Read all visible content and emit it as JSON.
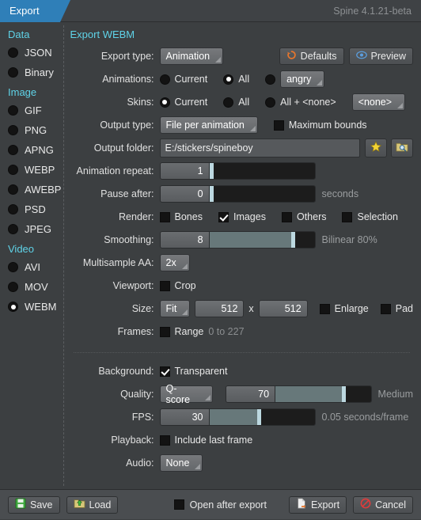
{
  "titlebar": {
    "tab_label": "Export",
    "app_title": "Spine 4.1.21-beta"
  },
  "sidebar": {
    "sections": [
      {
        "title": "Data",
        "items": [
          {
            "label": "JSON"
          },
          {
            "label": "Binary"
          }
        ]
      },
      {
        "title": "Image",
        "items": [
          {
            "label": "GIF"
          },
          {
            "label": "PNG"
          },
          {
            "label": "APNG"
          },
          {
            "label": "WEBP"
          },
          {
            "label": "AWEBP"
          },
          {
            "label": "PSD"
          },
          {
            "label": "JPEG"
          }
        ]
      },
      {
        "title": "Video",
        "items": [
          {
            "label": "AVI"
          },
          {
            "label": "MOV"
          },
          {
            "label": "WEBM"
          }
        ]
      }
    ],
    "selected": "WEBM"
  },
  "main": {
    "heading": "Export WEBM",
    "export_type": {
      "label": "Export type:",
      "value": "Animation"
    },
    "defaults_button": "Defaults",
    "preview_button": "Preview",
    "animations": {
      "label": "Animations:",
      "opt_current": "Current",
      "opt_all": "All",
      "selected_animation": "angry"
    },
    "skins": {
      "label": "Skins:",
      "opt_current": "Current",
      "opt_all": "All",
      "opt_all_none": "All + <none>",
      "selected_skin": "<none>"
    },
    "output_type": {
      "label": "Output type:",
      "value": "File per animation",
      "max_bounds_label": "Maximum bounds"
    },
    "output_folder": {
      "label": "Output folder:",
      "value": "E:/stickers/spineboy",
      "placeholder": "Output folder"
    },
    "animation_repeat": {
      "label": "Animation repeat:",
      "value": "1",
      "fill_percent": 0
    },
    "pause_after": {
      "label": "Pause after:",
      "value": "0",
      "fill_percent": 0,
      "suffix": "seconds"
    },
    "render": {
      "label": "Render:",
      "bones": "Bones",
      "images": "Images",
      "others": "Others",
      "selection": "Selection"
    },
    "smoothing": {
      "label": "Smoothing:",
      "value": "8",
      "fill_percent": 80,
      "suffix": "Bilinear 80%"
    },
    "multisample_aa": {
      "label": "Multisample AA:",
      "value": "2x"
    },
    "viewport": {
      "label": "Viewport:",
      "crop_label": "Crop"
    },
    "size": {
      "label": "Size:",
      "mode": "Fit",
      "width": "512",
      "separator": "x",
      "height": "512",
      "enlarge_label": "Enlarge",
      "pad_label": "Pad"
    },
    "frames": {
      "label": "Frames:",
      "range_label": "Range",
      "range_value": "0 to 227"
    },
    "background": {
      "label": "Background:",
      "transparent_label": "Transparent"
    },
    "quality": {
      "label": "Quality:",
      "mode": "Q-score",
      "value": "70",
      "fill_percent": 72,
      "suffix": "Medium"
    },
    "fps": {
      "label": "FPS:",
      "value": "30",
      "fill_percent": 48,
      "suffix": "0.05 seconds/frame"
    },
    "playback": {
      "label": "Playback:",
      "include_last_frame_label": "Include last frame"
    },
    "audio": {
      "label": "Audio:",
      "value": "None"
    }
  },
  "bottom": {
    "save_label": "Save",
    "load_label": "Load",
    "open_after_export_label": "Open after export",
    "export_label": "Export",
    "cancel_label": "Cancel"
  },
  "colors": {
    "accent_tab": "#2f7fb8",
    "section_heading": "#5fd3e8",
    "slider_fill": "#67787a",
    "slider_knob": "#bcd8e0",
    "star": "#f2d335",
    "defaults_icon": "#e8762c",
    "preview_icon": "#5b9fe0",
    "cancel_icon": "#e03b3b"
  }
}
